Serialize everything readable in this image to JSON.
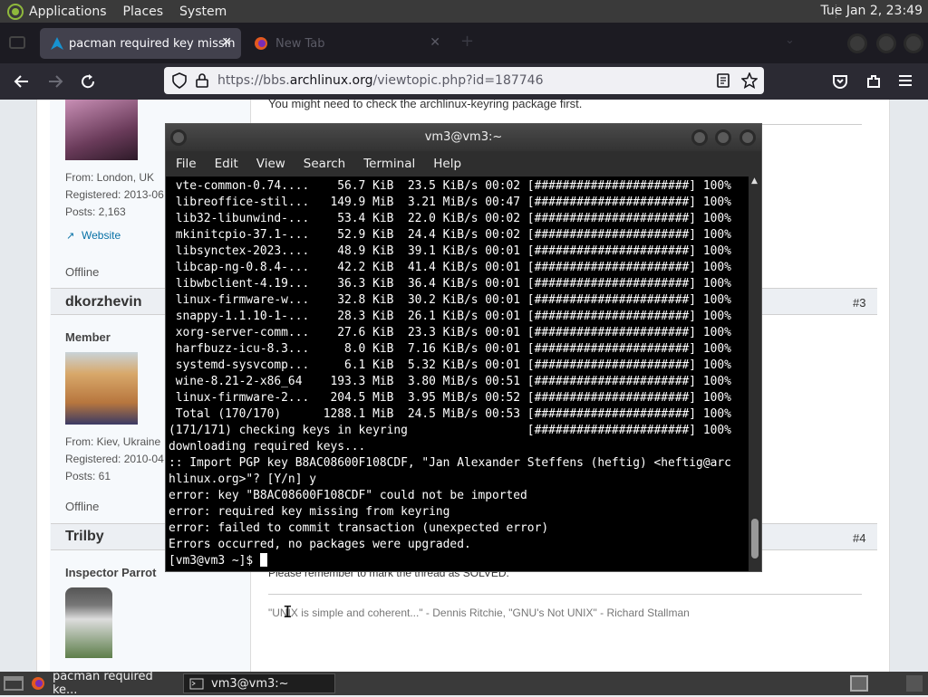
{
  "top_panel": {
    "menus": [
      "Applications",
      "Places",
      "System"
    ],
    "clock": "Tue Jan  2, 23:49"
  },
  "browser": {
    "tabs": [
      {
        "label": "pacman required key missin",
        "active": true
      },
      {
        "label": "New Tab",
        "active": false
      }
    ],
    "url_prefix": "https://bbs.",
    "url_domain": "archlinux.org",
    "url_path": "/viewtopic.php?id=187746"
  },
  "forum": {
    "top_post_text": "You might need to check the archlinux-keyring package first.",
    "user1": {
      "from": "From: London, UK",
      "registered": "Registered: 2013-06",
      "posts": "Posts: 2,163",
      "website": "Website",
      "status": "Offline"
    },
    "user2": {
      "name": "dkorzhevin",
      "post_number": "#3",
      "rank": "Member",
      "from": "From: Kiev, Ukraine",
      "registered": "Registered: 2010-04",
      "posts": "Posts: 61",
      "status": "Offline"
    },
    "user3": {
      "name": "Trilby",
      "post_number": "#4",
      "rank": "Inspector Parrot",
      "post_text": "Please remember to mark the thread as SOLVED.",
      "signature": "\"UNIX is simple and coherent...\" - Dennis Ritchie, \"GNU's Not UNIX\" -  Richard Stallman"
    }
  },
  "terminal": {
    "title": "vm3@vm3:~",
    "menu": [
      "File",
      "Edit",
      "View",
      "Search",
      "Terminal",
      "Help"
    ],
    "lines": [
      " vte-common-0.74....    56.7 KiB  23.5 KiB/s 00:02 [######################] 100%",
      " libreoffice-stil...   149.9 MiB  3.21 MiB/s 00:47 [######################] 100%",
      " lib32-libunwind-...    53.4 KiB  22.0 KiB/s 00:02 [######################] 100%",
      " mkinitcpio-37.1-...    52.9 KiB  24.4 KiB/s 00:02 [######################] 100%",
      " libsynctex-2023....    48.9 KiB  39.1 KiB/s 00:01 [######################] 100%",
      " libcap-ng-0.8.4-...    42.2 KiB  41.4 KiB/s 00:01 [######################] 100%",
      " libwbclient-4.19...    36.3 KiB  36.4 KiB/s 00:01 [######################] 100%",
      " linux-firmware-w...    32.8 KiB  30.2 KiB/s 00:01 [######################] 100%",
      " snappy-1.1.10-1-...    28.3 KiB  26.1 KiB/s 00:01 [######################] 100%",
      " xorg-server-comm...    27.6 KiB  23.3 KiB/s 00:01 [######################] 100%",
      " harfbuzz-icu-8.3...     8.0 KiB  7.16 KiB/s 00:01 [######################] 100%",
      " systemd-sysvcomp...     6.1 KiB  5.32 KiB/s 00:01 [######################] 100%",
      " wine-8.21-2-x86_64    193.3 MiB  3.80 MiB/s 00:51 [######################] 100%",
      " linux-firmware-2...   204.5 MiB  3.95 MiB/s 00:52 [######################] 100%",
      " Total (170/170)      1288.1 MiB  24.5 MiB/s 00:53 [######################] 100%",
      "(171/171) checking keys in keyring                 [######################] 100%",
      "downloading required keys...",
      ":: Import PGP key B8AC08600F108CDF, \"Jan Alexander Steffens (heftig) <heftig@arc",
      "hlinux.org>\"? [Y/n] y",
      "error: key \"B8AC08600F108CDF\" could not be imported",
      "error: required key missing from keyring",
      "error: failed to commit transaction (unexpected error)",
      "Errors occurred, no packages were upgraded.",
      "[vm3@vm3 ~]$ "
    ]
  },
  "taskbar": {
    "items": [
      "pacman required ke...",
      "vm3@vm3:~"
    ]
  }
}
